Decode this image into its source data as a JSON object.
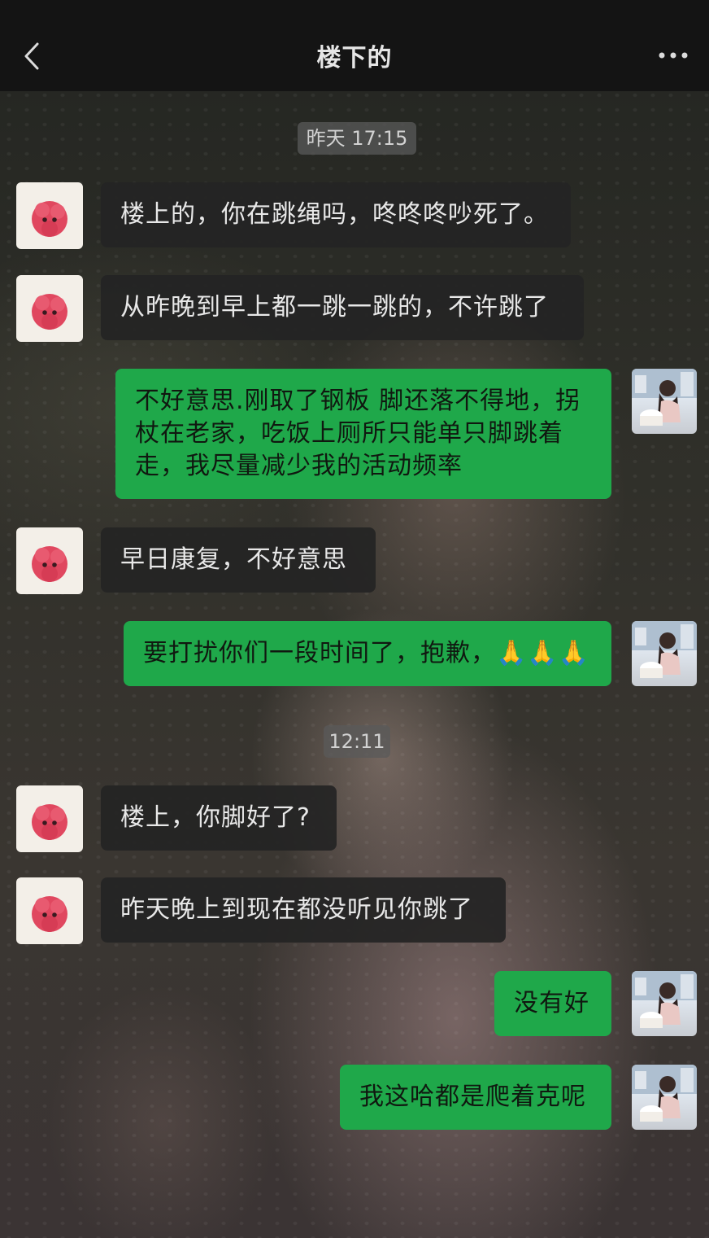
{
  "header": {
    "title": "楼下的"
  },
  "messages": [
    {
      "type": "timestamp",
      "text": "昨天 17:15"
    },
    {
      "side": "left",
      "text": "楼上的，你在跳绳吗，咚咚咚吵死了。"
    },
    {
      "side": "left",
      "text": "从昨晚到早上都一跳一跳的，不许跳了"
    },
    {
      "side": "right",
      "lines": [
        "不好意思.刚取了钢板 脚还落不得地，拐",
        "杖在老家，吃饭上厕所只能单只脚跳着",
        "走，我尽量减少我的活动频率"
      ]
    },
    {
      "side": "left",
      "text": "早日康复，不好意思"
    },
    {
      "side": "right",
      "text": "要打扰你们一段时间了，抱歉，🙏🙏🙏"
    },
    {
      "type": "timestamp",
      "text": "12:11"
    },
    {
      "side": "left",
      "text": "楼上，你脚好了?"
    },
    {
      "side": "left",
      "text": "昨天晚上到现在都没听见你跳了"
    },
    {
      "side": "right",
      "text": "没有好"
    },
    {
      "side": "right",
      "text": "我这哈都是爬着克呢"
    }
  ],
  "colors": {
    "out_bubble": "#1fa84a",
    "in_bubble": "#242424",
    "top_bar": "#141414",
    "avatar_flower": "#e0475f"
  },
  "icons": {
    "back": "chevron-left-icon",
    "more": "ellipsis-icon",
    "contact_avatar": "red-flower-avatar",
    "self_avatar": "photo-avatar"
  }
}
